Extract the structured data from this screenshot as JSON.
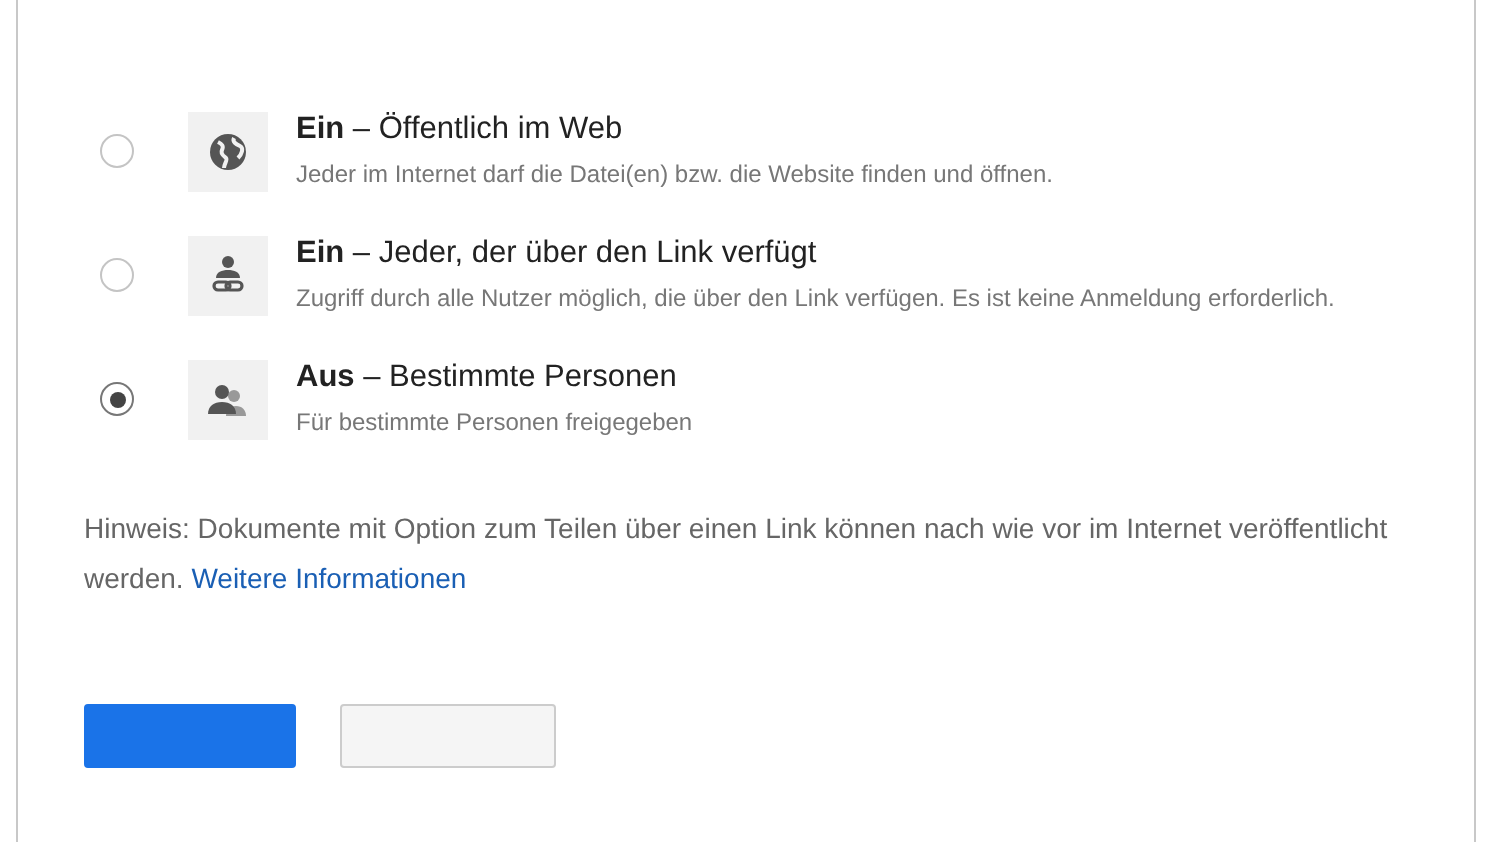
{
  "options": [
    {
      "kind": "globe",
      "title_bold": "Ein",
      "title": " – Öffentlich im Web",
      "description": "Jeder im Internet darf die Datei(en) bzw. die Website finden und öffnen.",
      "selected": false
    },
    {
      "kind": "link",
      "title_bold": "Ein",
      "title": " – Jeder, der über den Link verfügt",
      "description": "Zugriff durch alle Nutzer möglich, die über den Link verfügen. Es ist keine Anmeldung erforderlich.",
      "selected": false
    },
    {
      "kind": "people",
      "title_bold": "Aus",
      "title": " – Bestimmte Personen",
      "description": "Für bestimmte Personen freigegeben",
      "selected": true
    }
  ],
  "note": {
    "text": "Hinweis: Dokumente mit Option zum Teilen über einen Link können nach wie vor im Internet veröffentlicht werden.",
    "link": "Weitere Informationen"
  },
  "buttons": [
    {
      "kind": "primary"
    },
    {
      "kind": "secondary"
    }
  ]
}
